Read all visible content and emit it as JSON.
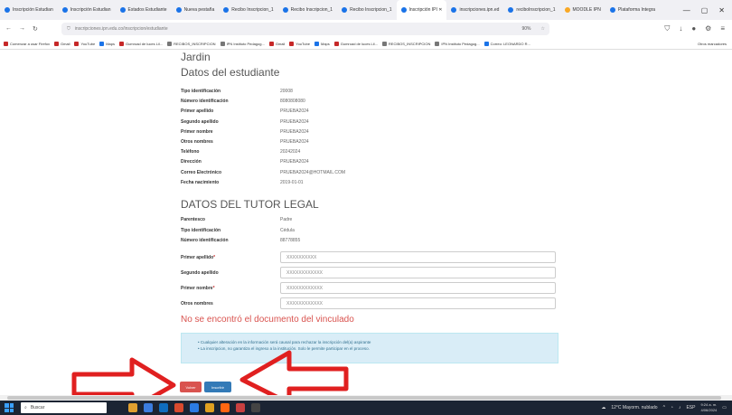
{
  "browser": {
    "tabs": [
      {
        "label": "Inscripción Estudian",
        "fav": "blue"
      },
      {
        "label": "Inscripción Estudian",
        "fav": "blue"
      },
      {
        "label": "Estados Estudiante",
        "fav": "blue"
      },
      {
        "label": "Nueva pestaña",
        "fav": "blue"
      },
      {
        "label": "Recibo Inscripcion_1",
        "fav": "blue"
      },
      {
        "label": "Recibo Inscripcion_1",
        "fav": "blue"
      },
      {
        "label": "Recibo Inscripcion_1",
        "fav": "blue"
      },
      {
        "label": "Inscripción IPI ✕",
        "fav": "blue",
        "active": true
      },
      {
        "label": "inscripciones.ipn.ed",
        "fav": "blue"
      },
      {
        "label": "reciboInscripcion_1",
        "fav": "blue"
      },
      {
        "label": "MOODLE IPN",
        "fav": "yellow"
      },
      {
        "label": "Plataforma Integra",
        "fav": "blue"
      }
    ],
    "url": "inscripciones.ipn.edu.co/inscripcion/estudiante",
    "zoom": "90%",
    "bookmarks": [
      {
        "label": "Comenzar a usar Firefox",
        "color": "red"
      },
      {
        "label": "Gmail",
        "color": "red"
      },
      {
        "label": "YouTube",
        "color": "red"
      },
      {
        "label": "Maps",
        "color": "blue"
      },
      {
        "label": "Gumroad de luces Lil...",
        "color": "red"
      },
      {
        "label": "RECIBOS_INSCRIPCION",
        "color": "gray"
      },
      {
        "label": "IPN Instituto Pedagog...",
        "color": "gray"
      },
      {
        "label": "Gmail",
        "color": "red"
      },
      {
        "label": "YouTube",
        "color": "red"
      },
      {
        "label": "Maps",
        "color": "blue"
      },
      {
        "label": "Gumroad de luces Lil...",
        "color": "red"
      },
      {
        "label": "RECIBOS_INSCRIPCION",
        "color": "gray"
      },
      {
        "label": "IPN Instituto Pedagog...",
        "color": "gray"
      },
      {
        "label": "Correo: LEONARDO R...",
        "color": "blue"
      }
    ],
    "other_bookmarks": "Otros marcadores"
  },
  "page": {
    "grade": "Jardin",
    "student_section_title": "Datos del estudiante",
    "student_fields": [
      {
        "label": "Tipo identificación",
        "value": "20008"
      },
      {
        "label": "Número identificación",
        "value": "8080808080"
      },
      {
        "label": "Primer apellido",
        "value": "PRUEBA2024"
      },
      {
        "label": "Segundo apellido",
        "value": "PRUEBA2024"
      },
      {
        "label": "Primer nombre",
        "value": "PRUEBA2024"
      },
      {
        "label": "Otros nombres",
        "value": "PRUEBA2024"
      },
      {
        "label": "Teléfono",
        "value": "20242024"
      },
      {
        "label": "Dirección",
        "value": "PRUEBA2024"
      },
      {
        "label": "Correo Electrónico",
        "value": "PRUEBA2024@HOTMAIL.COM"
      },
      {
        "label": "Fecha nacimiento",
        "value": "2019-01-01"
      }
    ],
    "tutor_section_title": "DATOS DEL TUTOR LEGAL",
    "tutor_fields": [
      {
        "label": "Parentesco",
        "value": "Padre"
      },
      {
        "label": "Tipo identificación",
        "value": "Cédula"
      },
      {
        "label": "Número identificación",
        "value": "88778855"
      }
    ],
    "tutor_inputs": [
      {
        "label": "Primer apellido",
        "required": "*",
        "value": "XXXXXXXXXX"
      },
      {
        "label": "Segundo apellido",
        "required": "",
        "value": "XXXXXXXXXXXX"
      },
      {
        "label": "Primer nombre",
        "required": "*",
        "value": "XXXXXXXXXXXX"
      },
      {
        "label": "Otros nombres",
        "required": "",
        "value": "XXXXXXXXXXXX"
      }
    ],
    "error_message": "No se encontró el documento del vinculado",
    "alert_lines": [
      "• Cualquier alteración en la información será causal para rechazar la inscripción del(a) aspirante",
      "• La inscripcion, no garantiza el ingreso a la institución. Solo le permite participar en el proceso."
    ],
    "back_button": "Volver",
    "submit_button": "Inscribir"
  },
  "colors": {
    "error": "#d9534f",
    "primary": "#337ab7",
    "alert_bg": "#d9edf7",
    "arrow": "#e02020"
  },
  "taskbar": {
    "search_placeholder": "Buscar",
    "weather": "12°C Mayorm. nublado",
    "lang": "ESP",
    "time": "9:24 a. m.",
    "date": "4/06/2024"
  }
}
